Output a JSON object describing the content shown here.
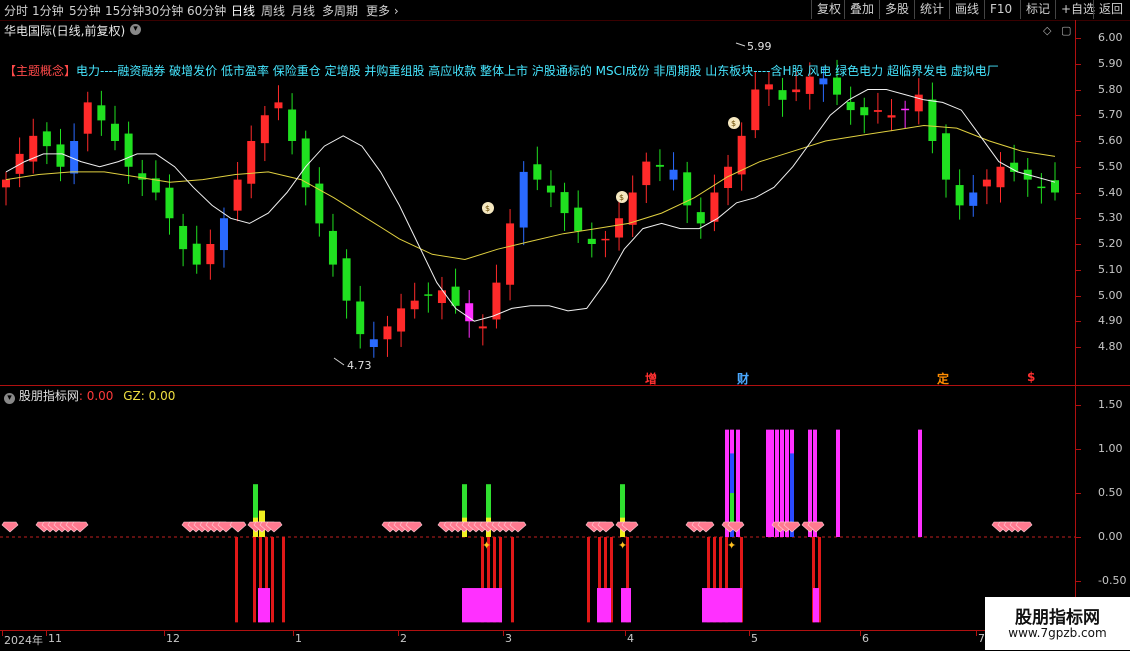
{
  "toolbar": {
    "periods": [
      "分时",
      "1分钟",
      "5分钟",
      "15分钟",
      "30分钟",
      "60分钟",
      "日线",
      "周线",
      "月线",
      "多周期",
      "更多"
    ],
    "buttons": [
      "复权",
      "叠加",
      "多股",
      "统计",
      "画线",
      "F10",
      "标记",
      "+自选",
      "返回"
    ]
  },
  "header": {
    "title": "华电国际(日线,前复权)"
  },
  "concept": {
    "tag": "【主题概念】",
    "text": "电力----融资融券 破增发价 低市盈率 保险重仓 定增股 并购重组股 高应收款 整体上市 沪股通标的 MSCI成份 非周期股 山东板块----含H股 风电 绿色电力 超临界发电 虚拟电厂"
  },
  "price_axis": {
    "labels": [
      "6.00",
      "5.90",
      "5.80",
      "5.70",
      "5.60",
      "5.50",
      "5.40",
      "5.30",
      "5.20",
      "5.10",
      "5.00",
      "4.90",
      "4.80"
    ]
  },
  "indicator": {
    "name": "股朋指标网",
    "value_label": ": 0.00",
    "gz_label": "GZ: 0.00",
    "axis_labels": [
      "1.50",
      "1.00",
      "0.50",
      "0.00",
      "-0.50"
    ]
  },
  "event_marks": [
    {
      "text": "增",
      "color": "#ff3030"
    },
    {
      "text": "财",
      "color": "#4aa8ff"
    },
    {
      "text": "定",
      "color": "#ff8c00"
    },
    {
      "text": "$",
      "color": "#ff3030"
    }
  ],
  "dates": [
    "2024年",
    "11",
    "12",
    "1",
    "2",
    "3",
    "4",
    "5",
    "6",
    "7"
  ],
  "watermark": {
    "line1": "股朋指标网",
    "line2": "www.7gpzb.com"
  },
  "chart_data": {
    "type": "candlestick",
    "title": "华电国际(日线,前复权)",
    "y_range": [
      4.7,
      6.05
    ],
    "annotations": [
      {
        "text": "5.99",
        "kind": "high"
      },
      {
        "text": "4.73",
        "kind": "low"
      }
    ],
    "series": [
      {
        "name": "candles",
        "values": [
          5.45,
          5.55,
          5.62,
          5.58,
          5.5,
          5.6,
          5.75,
          5.68,
          5.6,
          5.5,
          5.45,
          5.4,
          5.3,
          5.18,
          5.12,
          5.2,
          5.3,
          5.45,
          5.6,
          5.7,
          5.75,
          5.6,
          5.42,
          5.28,
          5.12,
          4.98,
          4.85,
          4.8,
          4.88,
          4.95,
          4.98,
          5.0,
          5.02,
          4.96,
          4.9,
          4.88,
          5.05,
          5.28,
          5.48,
          5.45,
          5.4,
          5.32,
          5.25,
          5.2,
          5.22,
          5.3,
          5.4,
          5.52,
          5.5,
          5.45,
          5.35,
          5.28,
          5.4,
          5.5,
          5.62,
          5.8,
          5.82,
          5.76,
          5.8,
          5.85,
          5.82,
          5.78,
          5.72,
          5.7,
          5.72,
          5.7,
          5.72,
          5.78,
          5.6,
          5.45,
          5.35,
          5.4,
          5.45,
          5.5,
          5.48,
          5.45,
          5.42,
          5.4
        ]
      },
      {
        "name": "ma-white",
        "values": [
          5.48,
          5.52,
          5.55,
          5.55,
          5.52,
          5.5,
          5.52,
          5.55,
          5.55,
          5.5,
          5.42,
          5.35,
          5.3,
          5.28,
          5.32,
          5.4,
          5.5,
          5.58,
          5.62,
          5.58,
          5.48,
          5.35,
          5.2,
          5.05,
          4.95,
          4.9,
          4.92,
          4.95,
          4.96,
          4.96,
          4.94,
          4.95,
          5.05,
          5.18,
          5.26,
          5.28,
          5.26,
          5.26,
          5.3,
          5.36,
          5.38,
          5.42,
          5.5,
          5.6,
          5.7,
          5.76,
          5.8,
          5.8,
          5.78,
          5.76,
          5.75,
          5.72,
          5.62,
          5.52,
          5.48,
          5.46,
          5.44
        ]
      },
      {
        "name": "ma-yellow",
        "values": [
          5.45,
          5.47,
          5.48,
          5.48,
          5.46,
          5.44,
          5.45,
          5.47,
          5.48,
          5.45,
          5.38,
          5.3,
          5.22,
          5.16,
          5.14,
          5.18,
          5.21,
          5.24,
          5.26,
          5.28,
          5.32,
          5.38,
          5.46,
          5.52,
          5.56,
          5.6,
          5.62,
          5.64,
          5.66,
          5.65,
          5.6,
          5.56,
          5.54
        ]
      }
    ],
    "indicator_series": {
      "name": "股朋指标网",
      "value": 0.0,
      "GZ": 0.0,
      "y_range": [
        -0.75,
        1.65
      ]
    }
  }
}
